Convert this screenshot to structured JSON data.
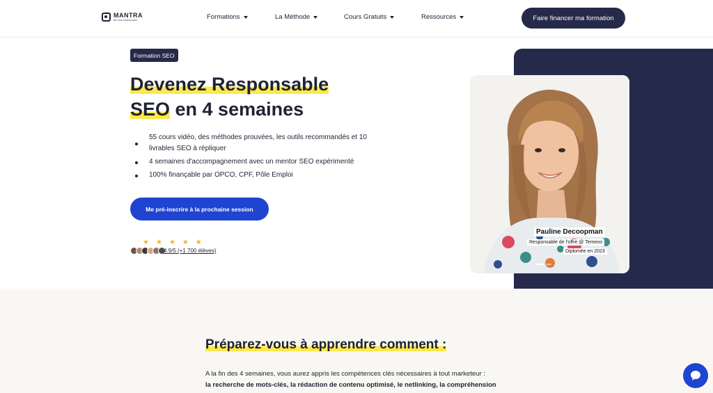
{
  "header": {
    "logo_text": "MANTRA",
    "logo_sub": "BETTER MARKETERS",
    "nav": [
      {
        "label": "Formations"
      },
      {
        "label": "La Méthode"
      },
      {
        "label": "Cours Gratuits"
      },
      {
        "label": "Ressources"
      }
    ],
    "cta_label": "Faire financer ma formation"
  },
  "hero": {
    "badge": "Formation SEO",
    "title_line1": "Devenez Responsable",
    "title_line2_hl": "SEO",
    "title_line2_rest": " en 4 semaines",
    "bullets": [
      "55 cours vidéo, des méthodes prouvées, les outils recommandés et 10 livrables SEO à répliquer",
      "4 semaines d'accompagnement avec un mentor SEO expérimenté",
      "100% finançable par OPCO, CPF, Pôle Emploi"
    ],
    "cta_label": "Me pré-inscrire à la prochaine session",
    "rating_text": "4.9/5 (+1 700 élèves)",
    "rating_stars": 5
  },
  "testimonial": {
    "name": "Pauline Decoopman",
    "role": "Responsable de l'offre @ Temeoo",
    "graduated": "Diplomée en 2023"
  },
  "section2": {
    "title": "Préparez-vous à apprendre comment :",
    "intro": "A la fin des 4 semaines, vous aurez appris les compétences clés nécessaires à tout marketeur :",
    "skills": "la recherche de mots-clés, la rédaction de contenu optimisé, le netlinking, la compréhension"
  },
  "colors": {
    "navy": "#25294a",
    "blue": "#1f44d1",
    "yellow": "#fbe94a",
    "star": "#f3b416"
  },
  "icons": [
    "logo-icon",
    "caret-down-icon",
    "star-icon",
    "chat-icon"
  ]
}
